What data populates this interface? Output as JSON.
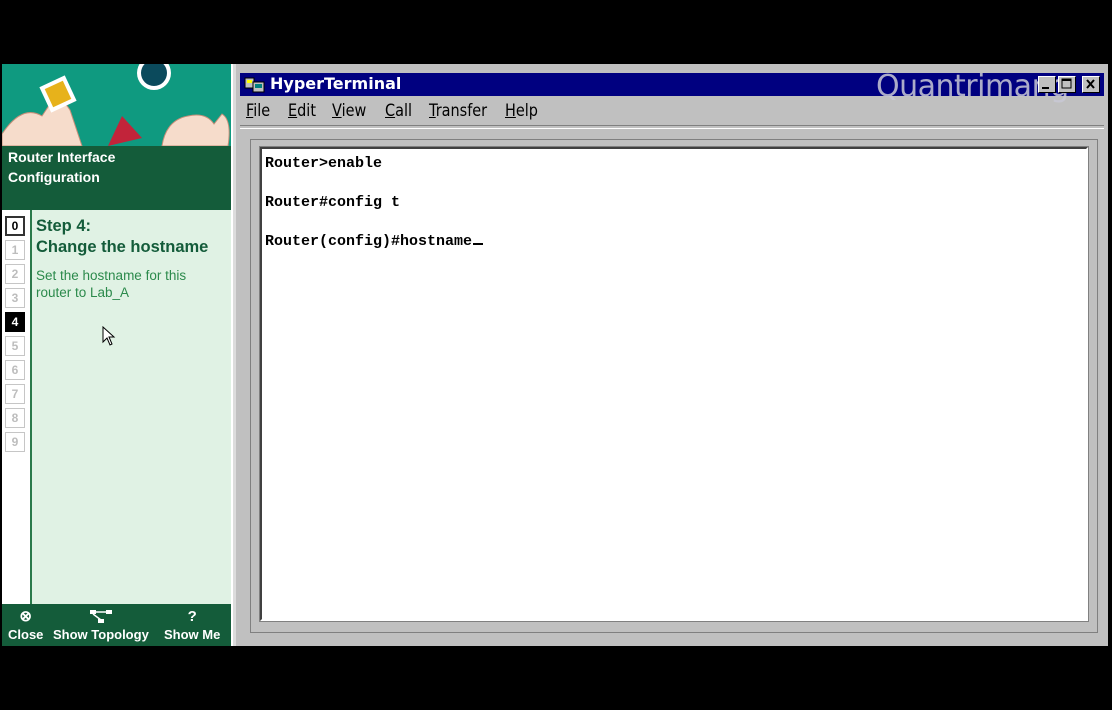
{
  "left_panel": {
    "title_line1": "Router Interface",
    "title_line2": "Configuration",
    "steps": [
      "0",
      "1",
      "2",
      "3",
      "4",
      "5",
      "6",
      "7",
      "8",
      "9"
    ],
    "completed_step": "0",
    "active_step": "4",
    "step_heading_line1": "Step 4:",
    "step_heading_line2": "Change the hostname",
    "step_description": "Set the hostname for this router to Lab_A",
    "bottom": {
      "close_label": "Close",
      "topology_label": "Show Topology",
      "showme_label": "Show Me",
      "showme_icon": "?"
    }
  },
  "window": {
    "title": "HyperTerminal",
    "watermark": "Quantrimang",
    "menu": [
      {
        "label": "File",
        "accel": "F",
        "rest": "ile"
      },
      {
        "label": "Edit",
        "accel": "E",
        "rest": "dit"
      },
      {
        "label": "View",
        "accel": "V",
        "rest": "iew"
      },
      {
        "label": "Call",
        "accel": "C",
        "rest": "all"
      },
      {
        "label": "Transfer",
        "accel": "T",
        "rest": "ransfer"
      },
      {
        "label": "Help",
        "accel": "H",
        "rest": "elp"
      }
    ],
    "terminal_lines": [
      "Router>enable",
      "Router#config t",
      "Router(config)#hostname"
    ]
  },
  "colors": {
    "banner_teal": "#0f9a80",
    "dark_green": "#145c3a",
    "panel_light_green": "#e0f2e4",
    "titlebar_navy": "#000080",
    "window_gray": "#c0c0c0"
  }
}
